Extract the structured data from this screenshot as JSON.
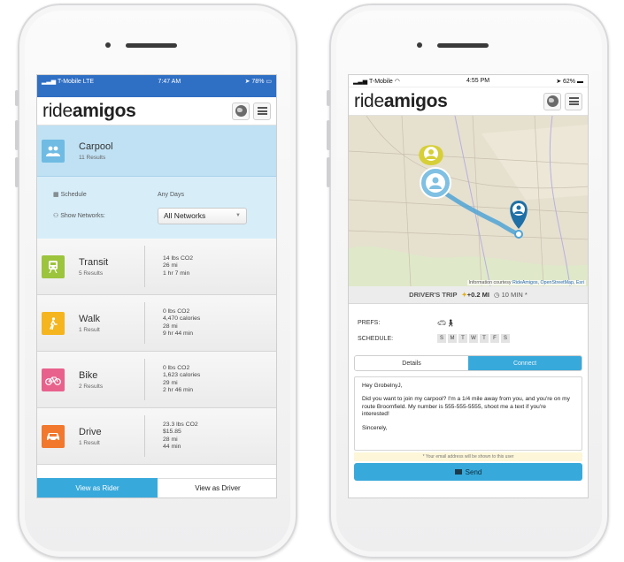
{
  "left_phone": {
    "status_bar": {
      "carrier": "T-Mobile",
      "network": "LTE",
      "time": "7:47 AM",
      "battery": "78%"
    },
    "call_banner": "",
    "app": {
      "logo_light": "ride",
      "logo_bold": "amigos"
    },
    "carpool": {
      "name": "Carpool",
      "results": "11 Results",
      "schedule_label": "Schedule",
      "schedule_value": "Any Days",
      "networks_label": "Show Networks:",
      "networks_selected": "All Networks"
    },
    "modes": [
      {
        "name": "Transit",
        "results": "5 Results",
        "color": "#9cc43c",
        "icon": "train-icon",
        "stats": [
          "14 lbs CO2",
          "26 mi",
          "1 hr 7 min"
        ]
      },
      {
        "name": "Walk",
        "results": "1 Result",
        "color": "#f5b51e",
        "icon": "walk-icon",
        "stats": [
          "0 lbs CO2",
          "4,470 calories",
          "28 mi",
          "9 hr 44 min"
        ]
      },
      {
        "name": "Bike",
        "results": "2 Results",
        "color": "#e8618c",
        "icon": "bike-icon",
        "stats": [
          "0 lbs CO2",
          "1,623 calories",
          "29 mi",
          "2 hr 46 min"
        ]
      },
      {
        "name": "Drive",
        "results": "1 Result",
        "color": "#f2782d",
        "icon": "car-icon",
        "stats": [
          "23.3 lbs CO2",
          "$15.85",
          "28 mi",
          "44 min"
        ]
      }
    ],
    "toggle": {
      "rider": "View as Rider",
      "driver": "View as Driver",
      "active": "rider"
    }
  },
  "right_phone": {
    "status_bar": {
      "carrier": "T-Mobile",
      "time": "4:55 PM",
      "battery": "62%"
    },
    "app": {
      "logo_light": "ride",
      "logo_bold": "amigos"
    },
    "map": {
      "credit_prefix": "Information courtesy ",
      "credit_link1": "RideAmigos",
      "credit_sep": ", ",
      "credit_link2": "OpenStreetMap",
      "credit_sep2": ", ",
      "credit_link3": "Esri",
      "route_color": "#4fa3d6",
      "pin_user_color": "#d6cf38",
      "pin_dest_color": "#1e6fa5"
    },
    "trip": {
      "title": "DRIVER'S TRIP",
      "distance": "+0.2 MI",
      "time": "10 MIN",
      "suffix": "*"
    },
    "prefs": {
      "prefs_label": "PREFS:",
      "schedule_label": "SCHEDULE:",
      "days": [
        "S",
        "M",
        "T",
        "W",
        "T",
        "F",
        "S"
      ]
    },
    "tabs": {
      "details": "Details",
      "connect": "Connect",
      "active": "connect"
    },
    "message": {
      "greeting": "Hey GrobelnyJ,",
      "body": "Did you want to join my carpool? I'm a 1/4 mile away from you, and you're on my route Broomfield. My number is 555-555-5555, shoot me a text if you're interested!",
      "closing": "Sincerely,"
    },
    "notice": "* Your email address will be shown to this user",
    "send_label": "Send"
  }
}
